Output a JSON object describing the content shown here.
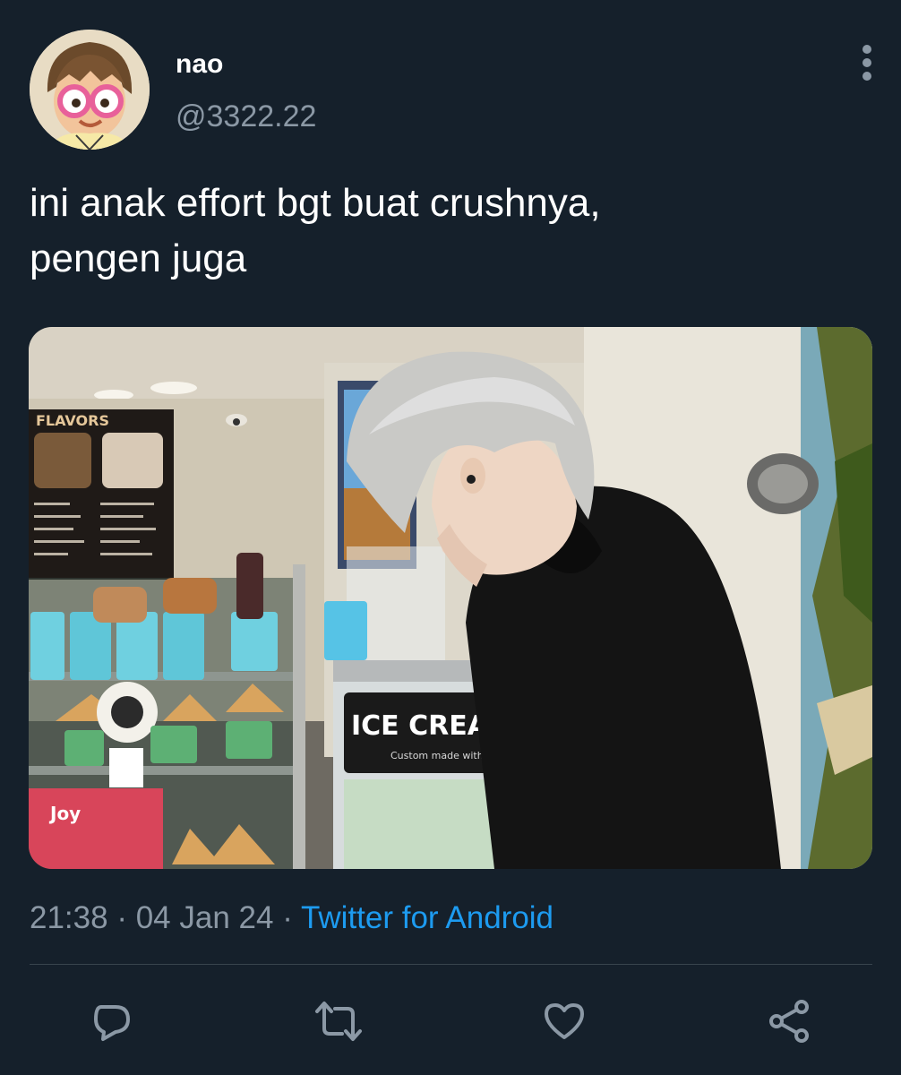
{
  "author": {
    "display_name": "nao",
    "handle": "@3322.22"
  },
  "tweet": {
    "text": "ini anak effort bgt buat crushnya,\npengen juga"
  },
  "media": {
    "board_title": "FLAVORS",
    "counter_sign": "ICE CREA",
    "counter_subtext": "Custom made with your fr",
    "cone_brand": "Joy"
  },
  "meta": {
    "time": "21:38",
    "separator": "·",
    "date": "04 Jan 24",
    "source": "Twitter for Android"
  },
  "icons": {
    "more": "more-vertical-icon",
    "reply": "reply-icon",
    "retweet": "retweet-icon",
    "like": "like-icon",
    "share": "share-icon"
  },
  "colors": {
    "background": "#15202b",
    "text_secondary": "#8b98a5",
    "accent": "#1d9bf0",
    "divider": "#38444d"
  }
}
